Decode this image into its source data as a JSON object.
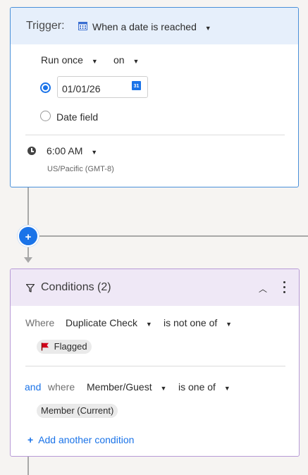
{
  "trigger": {
    "label": "Trigger:",
    "type": "When a date is reached",
    "frequency": "Run once",
    "on_label": "on",
    "date_value": "01/01/26",
    "date_field_label": "Date field",
    "time": "6:00 AM",
    "timezone": "US/Pacific (GMT-8)",
    "date_picker_day": "31"
  },
  "conditions": {
    "title": "Conditions (2)",
    "rows": [
      {
        "connector": "Where",
        "field": "Duplicate Check",
        "operator": "is not one of",
        "chip": "Flagged"
      },
      {
        "connector": "and",
        "connector2": "where",
        "field": "Member/Guest",
        "operator": "is one of",
        "chip": "Member (Current)"
      }
    ],
    "add_label": "Add another condition"
  },
  "colors": {
    "accent": "#1a73e8",
    "trigger_header": "#e6effb",
    "conditions_header": "#efe8f6",
    "flag": "#d0021b"
  }
}
